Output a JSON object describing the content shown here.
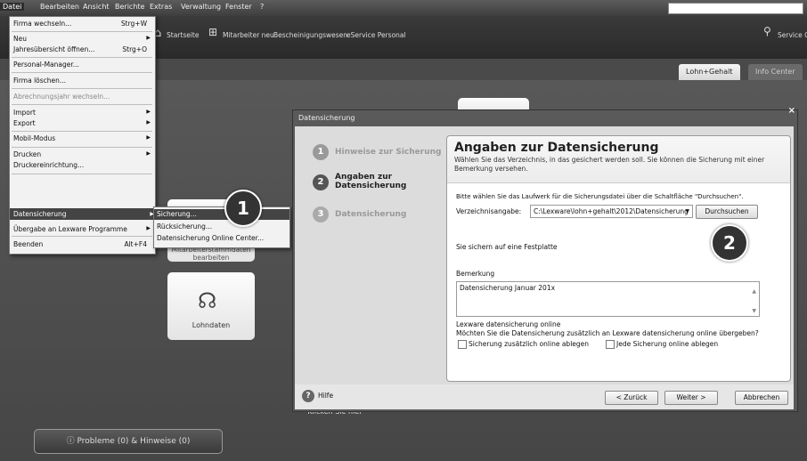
{
  "menubar": {
    "items": [
      "Datei",
      "Bearbeiten",
      "Ansicht",
      "Berichte",
      "Extras",
      "Verwaltung",
      "Fenster",
      "?"
    ]
  },
  "toolbar": {
    "startseite": "Startseite",
    "mitarbeiter_neu": "Mitarbeiter neu",
    "bescheinigungswesen": "Bescheinigungswesen",
    "eservice": "eService Personal",
    "service": "Service C"
  },
  "tabs": {
    "lohn_gehalt": "Lohn+Gehalt",
    "info_center": "Info Center"
  },
  "datei_menu": {
    "firma_wechseln": "Firma wechseln...",
    "firma_wechseln_sc": "Strg+W",
    "neu": "Neu",
    "jahresuebersicht": "Jahresübersicht öffnen...",
    "jahresuebersicht_sc": "Strg+O",
    "personal_manager": "Personal-Manager...",
    "firma_loeschen": "Firma löschen...",
    "abrechnungsjahr": "Abrechnungsjahr wechseln...",
    "import": "Import",
    "export": "Export",
    "mobil_modus": "Mobil-Modus",
    "drucken": "Drucken",
    "druckereinrichtung": "Druckereinrichtung...",
    "datensicherung": "Datensicherung",
    "uebergabe": "Übergabe an Lexware Programme",
    "beenden": "Beenden",
    "beenden_sc": "Alt+F4"
  },
  "sub_menu": {
    "sicherung": "Sicherung...",
    "ruecksicherung": "Rücksicherung...",
    "online_center": "Datensicherung Online Center..."
  },
  "badges": {
    "one": "1",
    "two": "2"
  },
  "tiles": {
    "lohndaten": "Lohndaten",
    "behind_tile": "Mitarbeiterstammdaten bearbeiten"
  },
  "dialog": {
    "title": "Datensicherung",
    "steps": [
      {
        "num": "1",
        "label": "Hinweise zur Sicherung"
      },
      {
        "num": "2",
        "label": "Angaben zur Datensicherung"
      },
      {
        "num": "3",
        "label": "Datensicherung"
      }
    ],
    "heading": "Angaben zur Datensicherung",
    "subheading": "Wählen Sie das Verzeichnis, in das gesichert werden soll. Sie können die Sicherung mit einer Bemerkung versehen.",
    "instruction": "Bitte wählen Sie das Laufwerk für die Sicherungsdatei über die Schaltfläche \"Durchsuchen\".",
    "verzeichnis_label": "Verzeichnisangabe:",
    "verzeichnis_value": "C:\\Lexware\\lohn+gehalt\\2012\\Datensicherung",
    "durchsuchen": "Durchsuchen",
    "festplatte": "Sie sichern auf eine Festplatte",
    "bemerkung_label": "Bemerkung",
    "bemerkung_value": "Datensicherung Januar 201x",
    "online_title": "Lexware datensicherung online",
    "online_question": "Möchten Sie die Datensicherung zusätzlich an Lexware datensicherung online übergeben?",
    "cb_zusaetzlich": "Sicherung zusätzlich online ablegen",
    "cb_jede": "Jede Sicherung online ablegen",
    "hilfe": "Hilfe",
    "zurueck": "< Zurück",
    "weiter": "Weiter >",
    "abbrechen": "Abbrechen"
  },
  "background_hint": "• Klicken Sie hier",
  "probleme": "Probleme (0) & Hinweise (0)"
}
